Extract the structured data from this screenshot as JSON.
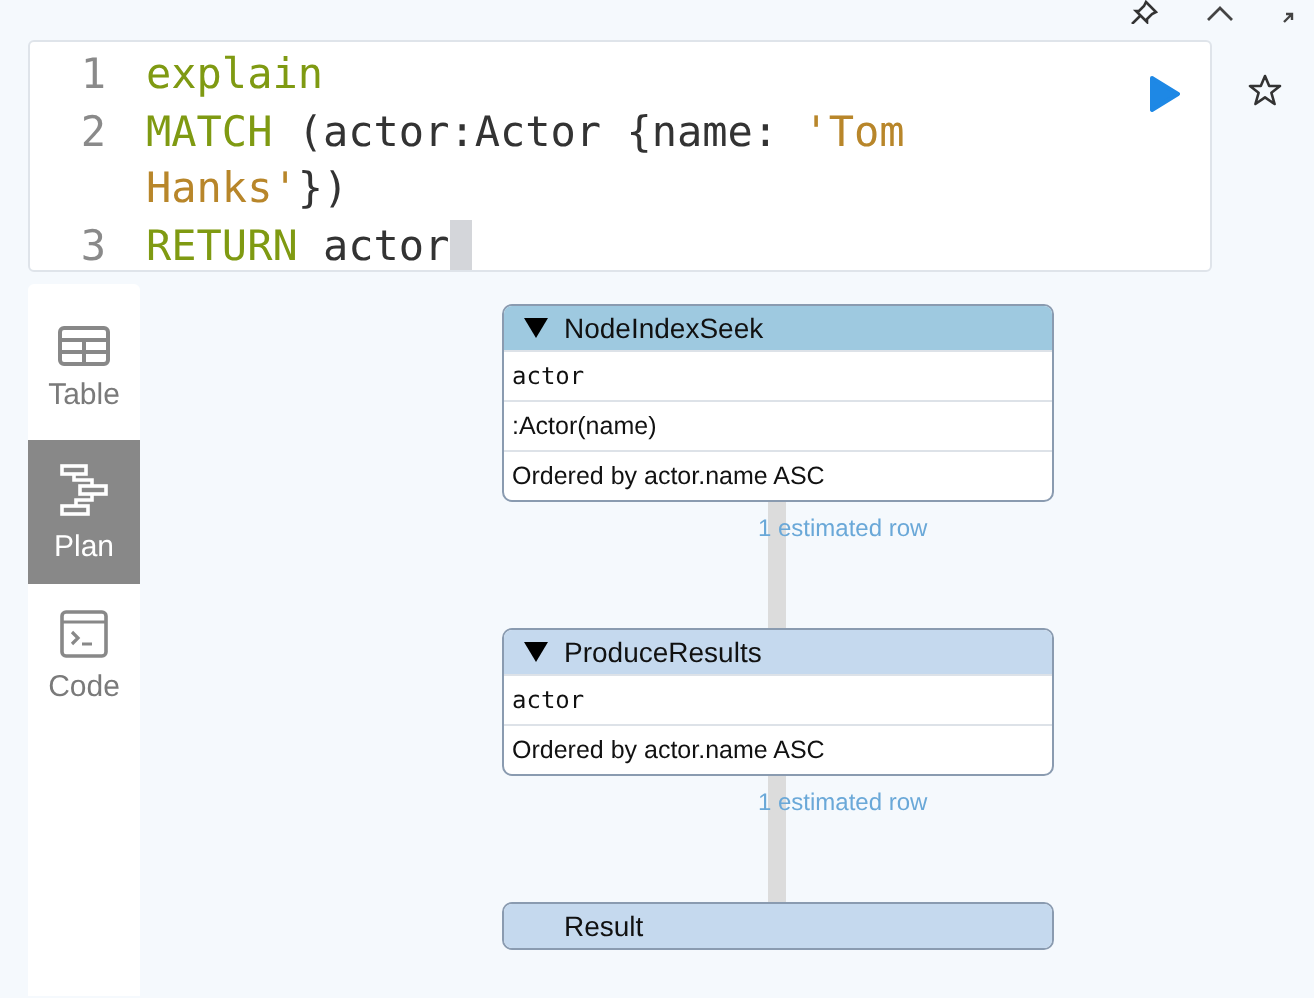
{
  "editor": {
    "lines": [
      {
        "number": "1",
        "cursor": false,
        "tokens": [
          {
            "kind": "keyword",
            "text": "explain"
          }
        ]
      },
      {
        "number": "2",
        "cursor": false,
        "tokens": [
          {
            "kind": "keyword",
            "text": "MATCH"
          },
          {
            "kind": "plain",
            "text": " (actor:Actor {name: "
          },
          {
            "kind": "string",
            "text": "'Tom Hanks'"
          },
          {
            "kind": "plain",
            "text": "})"
          }
        ]
      },
      {
        "number": "3",
        "cursor": true,
        "tokens": [
          {
            "kind": "keyword",
            "text": "RETURN"
          },
          {
            "kind": "plain",
            "text": " actor"
          }
        ]
      }
    ]
  },
  "view_tabs": [
    {
      "label": "Table",
      "selected": false
    },
    {
      "label": "Plan",
      "selected": true
    },
    {
      "label": "Code",
      "selected": false
    }
  ],
  "plan": {
    "operators": [
      {
        "kind": "operator",
        "name": "NodeIndexSeek",
        "expanded": true,
        "color": "#9ec9e0",
        "rows": [
          {
            "kind": "identifiers",
            "text": "actor"
          },
          {
            "kind": "detail",
            "text": ":Actor(name)"
          },
          {
            "kind": "detail",
            "text": "Ordered by actor.name ASC"
          }
        ],
        "estimate": "1 estimated row"
      },
      {
        "kind": "operator",
        "name": "ProduceResults",
        "expanded": true,
        "color": "#c5d9ee",
        "rows": [
          {
            "kind": "identifiers",
            "text": "actor"
          },
          {
            "kind": "detail",
            "text": "Ordered by actor.name ASC"
          }
        ],
        "estimate": "1 estimated row"
      },
      {
        "kind": "result",
        "name": "Result",
        "color": "#c5d9ee"
      }
    ]
  }
}
